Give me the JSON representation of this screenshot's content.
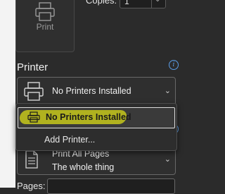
{
  "print": {
    "label": "Print"
  },
  "copies": {
    "label": "Copies:",
    "value": "1"
  },
  "printer": {
    "title": "Printer",
    "selected": "No Printers Installed",
    "options": [
      {
        "label": "No Printers Installed"
      },
      {
        "label": "Add Printer..."
      }
    ]
  },
  "settings": {
    "line1": "Print All Pages",
    "line2": "The whole thing"
  },
  "pages": {
    "label": "Pages:",
    "value": ""
  },
  "colors": {
    "background": "#2b2b2b",
    "highlight": "#c7c81b",
    "info": "#5a9de6"
  }
}
